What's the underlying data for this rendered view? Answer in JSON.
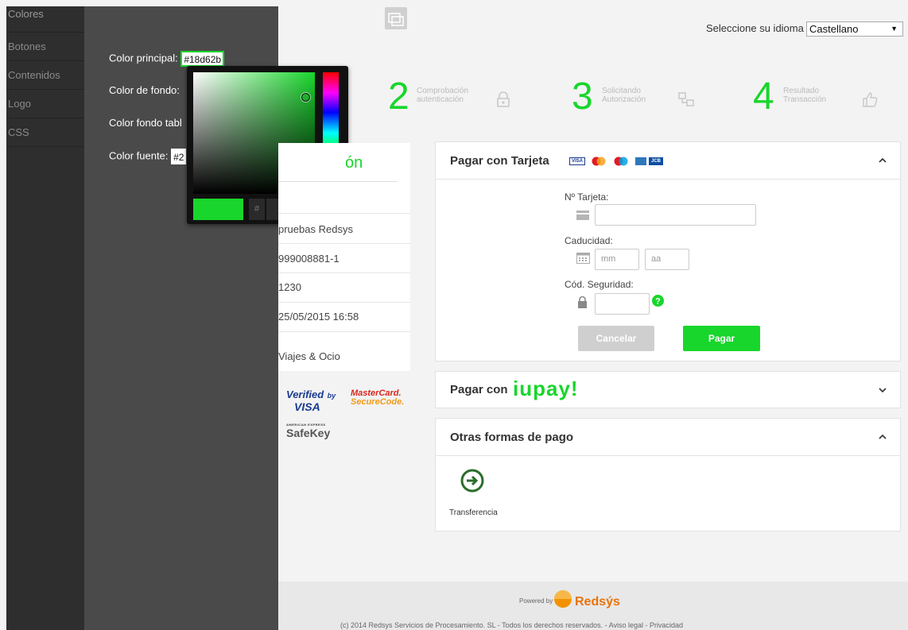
{
  "colors": {
    "accent": "#18d62b",
    "nav_bg": "#2e2e2e",
    "panel_bg": "#4a4a4a",
    "page_bg": "#f3f3f3",
    "cancel_bg": "#cfcfcf"
  },
  "nav": {
    "items": [
      {
        "label": "Colores"
      },
      {
        "label": "Botones"
      },
      {
        "label": "Contenidos"
      },
      {
        "label": "Logo"
      },
      {
        "label": "CSS"
      }
    ]
  },
  "settings": {
    "primary_label": "Color principal:",
    "primary_value": "#18d62b",
    "background_label": "Color de fondo:",
    "table_bg_label": "Color fondo tabl",
    "font_label": "Color fuente:",
    "font_value": "#2"
  },
  "picker": {
    "hash": "#",
    "hex": "18d62b"
  },
  "header": {
    "language_label": "Seleccione su idioma",
    "language_value": "Castellano",
    "frame_icon": "window-icon"
  },
  "steps": [
    {
      "number": "2",
      "line1": "Comprobación",
      "line2": "autenticación",
      "icon": "lock-icon"
    },
    {
      "number": "3",
      "line1": "Solicitando",
      "line2": "Autorización",
      "icon": "network-icon"
    },
    {
      "number": "4",
      "line1": "Resultado",
      "line2": "Transacción",
      "icon": "thumbs-up-icon"
    }
  ],
  "info": {
    "title_fragment": "ón",
    "rows": [
      "pruebas Redsys",
      "999008881-1",
      "1230",
      "25/05/2015  16:58",
      "Viajes & Ocio"
    ]
  },
  "secure": {
    "verified_line1": "Verified",
    "verified_by": "by",
    "verified_line2": "VISA",
    "mastercard_line1": "MasterCard.",
    "mastercard_line2": "SecureCode.",
    "amex_small": "AMERICAN EXPRESS",
    "safekey": "SafeKey"
  },
  "card_payment": {
    "title": "Pagar con Tarjeta",
    "card_number_label": "Nº Tarjeta:",
    "card_number_value": "",
    "expiry_label": "Caducidad:",
    "month_placeholder": "mm",
    "year_placeholder": "aa",
    "cvv_label": "Cód. Seguridad:",
    "cvv_value": "",
    "cancel_label": "Cancelar",
    "pay_label": "Pagar",
    "brand_icons": [
      "visa-icon",
      "mastercard-icon",
      "maestro-icon",
      "amex-icon",
      "jcb-icon"
    ],
    "brands": {
      "visa": "VISA",
      "jcb": "JCB"
    }
  },
  "iupay": {
    "title": "Pagar con",
    "logo": "iupay!"
  },
  "other": {
    "title": "Otras formas de pago",
    "transfer_label": "Transferencia"
  },
  "footer": {
    "powered_by": "Powered by",
    "brand": "Redsýs",
    "copyright": "(c) 2014 Redsys Servicios de Procesamiento. SL - Todos los derechos reservados. -  Aviso legal -  Privacidad"
  }
}
